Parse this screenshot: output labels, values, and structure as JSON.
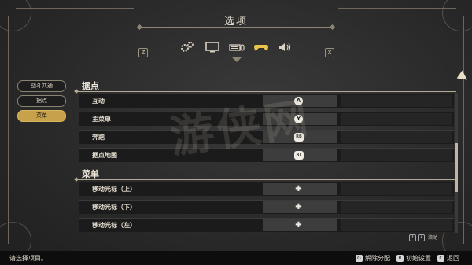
{
  "window": {
    "title": "选项"
  },
  "tabs": {
    "left_key": "Z",
    "right_key": "X",
    "items": [
      {
        "icon": "gears-icon",
        "label": ""
      },
      {
        "icon": "monitor-icon",
        "label": ""
      },
      {
        "icon": "keyboard-mouse-icon",
        "label": ""
      },
      {
        "icon": "gamepad-icon",
        "label": "",
        "active": true
      },
      {
        "icon": "speaker-icon",
        "label": ""
      }
    ],
    "active_color": "#e8c44a"
  },
  "sidebar": {
    "items": [
      {
        "label": "战斗共通"
      },
      {
        "label": "据点"
      },
      {
        "label": "菜单",
        "active": true
      }
    ]
  },
  "sections": [
    {
      "title": "据点",
      "rows": [
        {
          "label": "互动",
          "glyph": "A"
        },
        {
          "label": "主菜单",
          "glyph": "Y"
        },
        {
          "label": "奔跑",
          "glyph": "RB"
        },
        {
          "label": "据点地图",
          "glyph": "RT"
        }
      ]
    },
    {
      "title": "菜单",
      "rows": [
        {
          "label": "移动光标（上）",
          "glyph": "✚"
        },
        {
          "label": "移动光标（下）",
          "glyph": "✚"
        },
        {
          "label": "移动光标（左）",
          "glyph": "✚"
        }
      ]
    }
  ],
  "scroll_hint": {
    "key1": "↑",
    "key2": "↓",
    "text": "滚动"
  },
  "footer": {
    "status": "请选择项目。",
    "actions": [
      {
        "key": "G",
        "label": "解除分配"
      },
      {
        "key": "R",
        "label": "初始设置"
      },
      {
        "key": "C",
        "label": "返回"
      }
    ]
  },
  "watermark": "游侠网"
}
